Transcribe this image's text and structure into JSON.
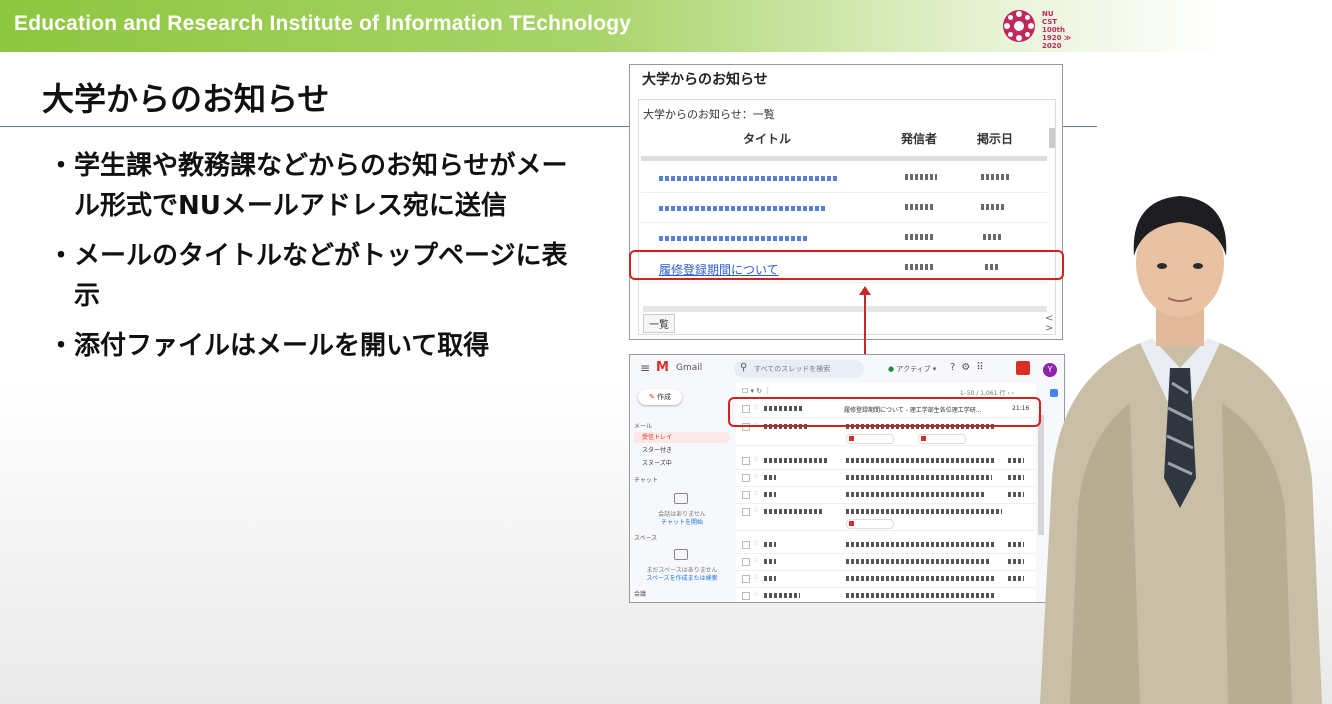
{
  "banner": {
    "text": "Education and Research Institute of Information TEchnology"
  },
  "logo": {
    "line1": "NU",
    "line2": "CST",
    "line3": "100th",
    "line4": "1920 ≫ 2020",
    "color": "#c0285c"
  },
  "slide": {
    "title": "大学からのお知らせ",
    "bullets": [
      "学生課や教務課などからのお知らせがメール形式でNUメールアドレス宛に送信",
      "メールのタイトルなどがトップページに表示",
      "添付ファイルはメールを開いて取得"
    ],
    "bullet_marker": "・"
  },
  "portal": {
    "title": "大学からのお知らせ",
    "subtitle": "大学からのお知らせ：一覧",
    "columns": [
      "タイトル",
      "発信者",
      "掲示日"
    ],
    "highlighted_link": "履修登録期間について",
    "list_button": "一覧",
    "scroll_left": "<",
    "scroll_right": ">"
  },
  "gmail": {
    "menu_icon": "≡",
    "logo_letter": "M",
    "logo_text": "Gmail",
    "search_placeholder": "すべてのスレッドを検索",
    "status": "アクティブ ▾",
    "avatar_letter": "Y",
    "toolbar": "☐ ▾   ↻   ⋮",
    "count": "1–50 / 1,061 行  ‹  ›",
    "compose": "作成",
    "section_mail": "メール",
    "nav": [
      "受信トレイ",
      "スター付き",
      "スヌーズ中"
    ],
    "section_chat": "チャット",
    "chat_empty_1": "会話はありません",
    "chat_empty_2": "チャットを開始",
    "section_spaces": "スペース",
    "spaces_empty_1": "まだスペースはありません",
    "spaces_empty_2": "スペースを作成または検索",
    "section_meet": "会議",
    "first_subject": "履修登録期間について - 理工学部生各位理工学研...",
    "first_time": "21:16"
  },
  "colors": {
    "accent_green": "#8dc63f",
    "highlight_red": "#d42020",
    "link_blue": "#2a5bd7"
  }
}
